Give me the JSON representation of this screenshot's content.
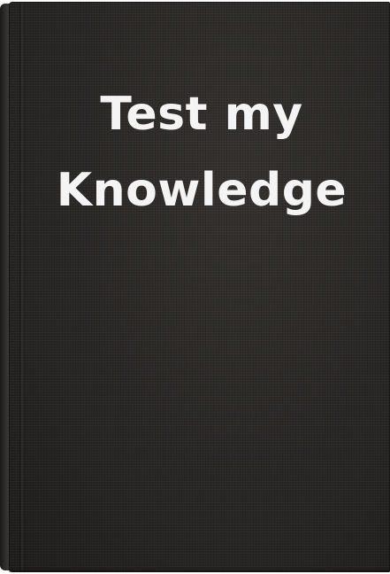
{
  "cover": {
    "title_line_1": "Test my",
    "title_line_2": "Knowledge",
    "colors": {
      "cover": "#2a2826",
      "title_text": "#f4f4f4"
    }
  }
}
